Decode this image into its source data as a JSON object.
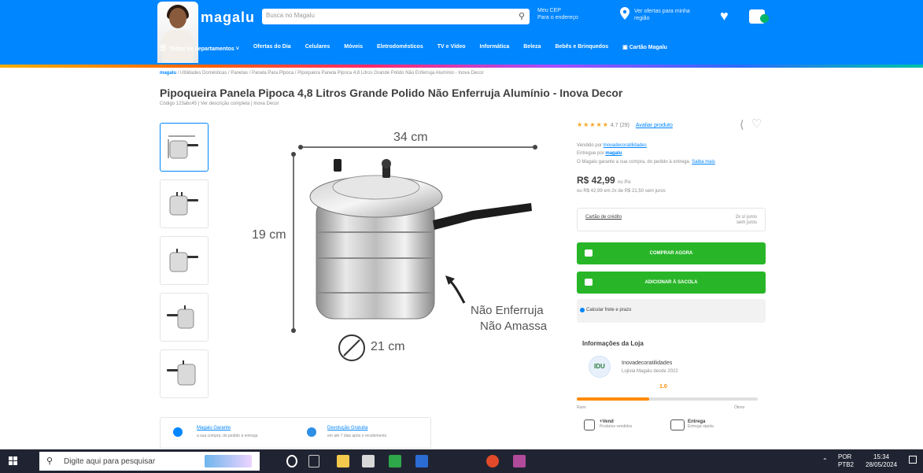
{
  "colors": {
    "brand_blue": "#0086ff",
    "buy_green": "#28b628",
    "rating_orange": "#ff8a00",
    "star_yellow": "#f5a623",
    "taskbar": "#202432"
  },
  "header": {
    "logo": "magalu",
    "search_placeholder": "Busca no Magalu",
    "cep_line1": "Meu CEP",
    "cep_line2": "Para o endereço",
    "location_line1": "Ver ofertas para minha",
    "location_line2": "região",
    "nav": [
      "Todos os departamentos",
      "Ofertas do Dia",
      "Celulares",
      "Móveis",
      "Eletrodomésticos",
      "TV e Vídeo",
      "Informática",
      "Beleza",
      "Bebês e Brinquedos",
      "Cartão Magalu"
    ]
  },
  "breadcrumb": {
    "home": "magalu",
    "path": "/ Utilidades Domésticas / Panelas / Panela Para Pipoca / Pipoqueira Panela Pipoca 4,8 Litros Grande Polido Não Enferruja Alumínio - Inova Decor"
  },
  "product": {
    "title": "Pipoqueira Panela Pipoca 4,8 Litros Grande Polido Não Enferruja Alumínio - Inova Decor",
    "code_line": "Código 123abc45 | Ver descrição completa | Inova Decor",
    "image_labels": {
      "width": "34 cm",
      "height": "19 cm",
      "diameter": "21 cm",
      "feature1": "Não Enferruja",
      "feature2": "Não Amassa"
    }
  },
  "buybox": {
    "rating_value": 4.7,
    "rating_text": "4.7 (29)",
    "rating_link": "Avaliar produto",
    "sold_by_prefix": "Vendido por",
    "seller": "Inovadecoratilidades",
    "delivered_prefix": "Entregue por",
    "delivered_by": "magalu",
    "guarantee": "O Magalu garante a sua compra, do pedido à entrega.",
    "guarantee_link": "Saiba mais",
    "price": "R$ 42,99",
    "price_suffix": "no Pix",
    "installments": "ou R$ 42,99 em 2x de R$ 21,50 sem juros",
    "card_label": "Cartão de crédito",
    "card_value_line1": "2x s/ juros",
    "card_value_line2": "sem juros",
    "buy_button": "COMPRAR AGORA",
    "bag_button": "ADICIONAR À SACOLA",
    "shipping": "Calcular frete e prazo"
  },
  "store": {
    "title": "Informações da Loja",
    "logo_text": "IDU",
    "name": "Inovadecoratilidades",
    "since": "Lojista Magalu desde 2022",
    "score": "1.0",
    "score_fraction": 0.4,
    "scale_min": "Ruim",
    "scale_max": "Ótimo",
    "badge1_title": "+Vend",
    "badge1_sub": "Produtos vendidos",
    "badge2_title": "Entrega",
    "badge2_sub": "Entrega rápida"
  },
  "promos": [
    {
      "title": "Magalu Garante",
      "sub": "a sua compra, do pedido à entrega"
    },
    {
      "title": "Devolução Gratuita",
      "sub": "em até 7 dias após o recebimento"
    }
  ],
  "taskbar": {
    "search_text": "Digite aqui para pesquisar",
    "lang1": "POR",
    "lang2": "PTB2",
    "time": "15:34",
    "date": "28/05/2024"
  }
}
